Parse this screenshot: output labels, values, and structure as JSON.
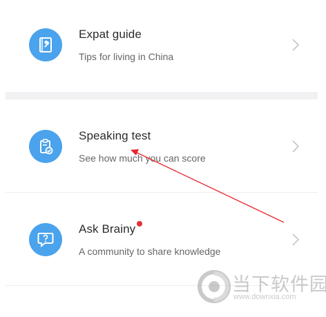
{
  "items": [
    {
      "title": "Expat guide",
      "subtitle": "Tips for living in China",
      "icon": "book-wrench-icon"
    },
    {
      "title": "Speaking test",
      "subtitle": "See how much you can score",
      "icon": "clipboard-check-icon"
    },
    {
      "title": "Ask Brainy",
      "subtitle": "A community to share knowledge",
      "icon": "question-bubble-icon",
      "has_notification_dot": true
    }
  ],
  "colors": {
    "icon_background": "#4aa3ec",
    "notification_dot": "#e2303c",
    "annotation_arrow": "#e8262e",
    "section_gap": "#f1f1f3"
  },
  "watermark": {
    "cn_text": "当下软件园",
    "url": "www.downxia.com"
  }
}
